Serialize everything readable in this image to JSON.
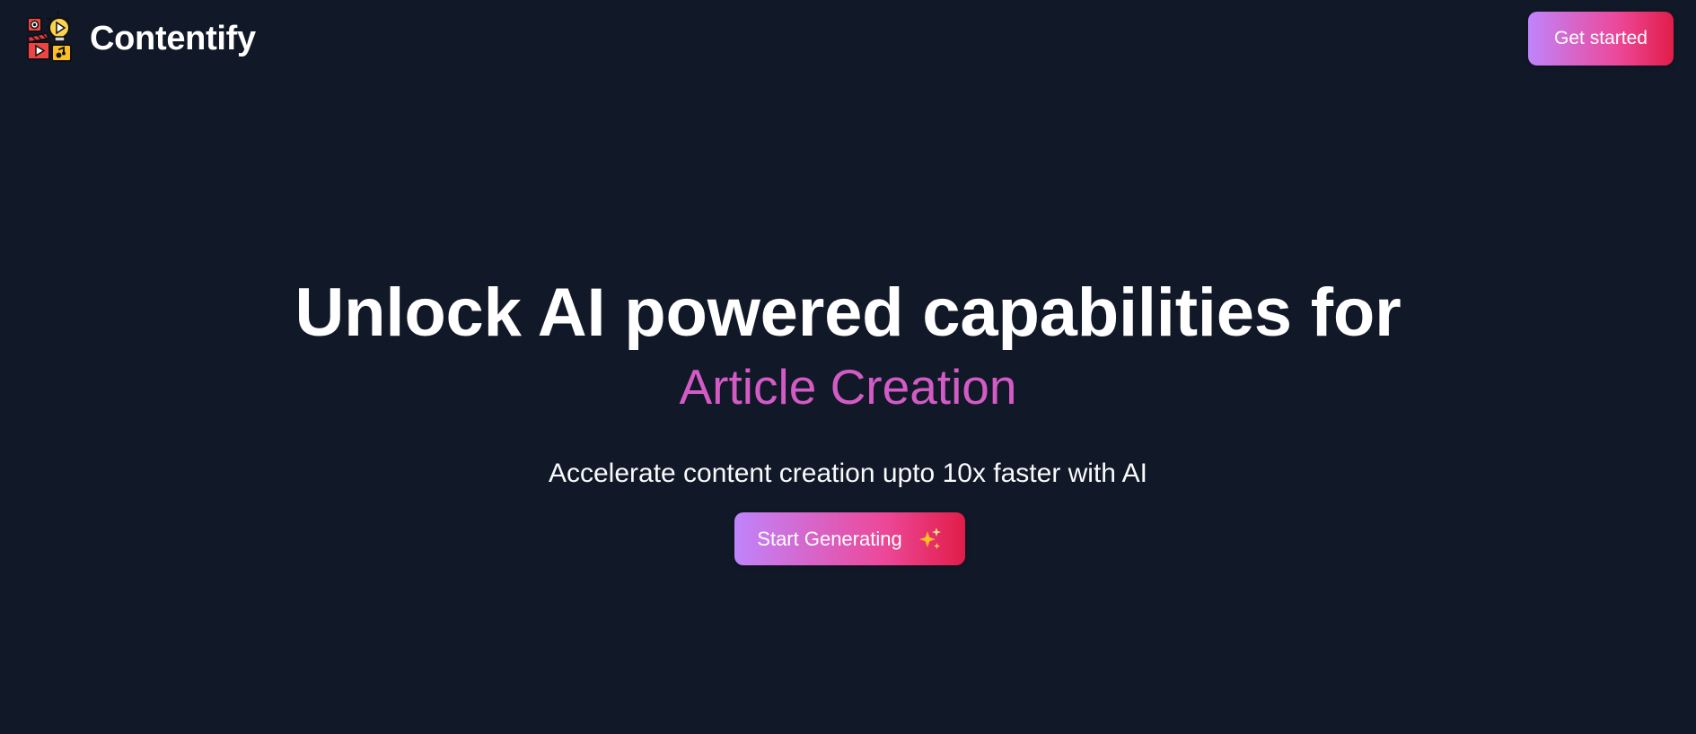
{
  "app": {
    "brand_name": "Contentify",
    "logo_icon": "content-creation-logo-icon",
    "background_color": "#111827"
  },
  "navbar": {
    "cta_label": "Get started"
  },
  "hero": {
    "title": "Unlock AI powered capabilities for",
    "highlight": "Article Creation",
    "subtitle": "Accelerate content creation upto 10x faster with AI",
    "button_label": "Start Generating",
    "button_icon": "sparkles-icon"
  },
  "colors": {
    "accent_gradient_start": "#c084fc",
    "accent_gradient_end": "#e11d48",
    "highlight_text": "#d25bc5",
    "sparkles": "#fbbf24"
  }
}
